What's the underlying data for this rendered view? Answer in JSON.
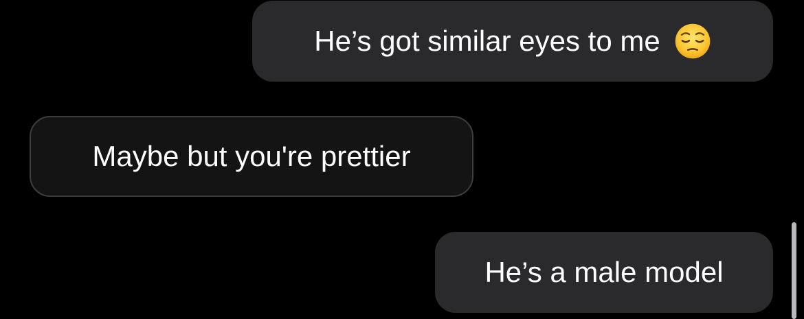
{
  "thread": {
    "messages": [
      {
        "direction": "sent",
        "text": "He’s got similar eyes to me",
        "emoji": "pensive-face"
      },
      {
        "direction": "received",
        "text": "Maybe but you're prettier"
      },
      {
        "direction": "sent",
        "text": "He’s a male model"
      }
    ]
  },
  "colors": {
    "background": "#000000",
    "sent_bubble": "#2a2a2c",
    "received_bubble": "#141414",
    "received_border": "#3d3d3f",
    "text": "#ffffff",
    "scrollbar": "#b9b9bd"
  }
}
